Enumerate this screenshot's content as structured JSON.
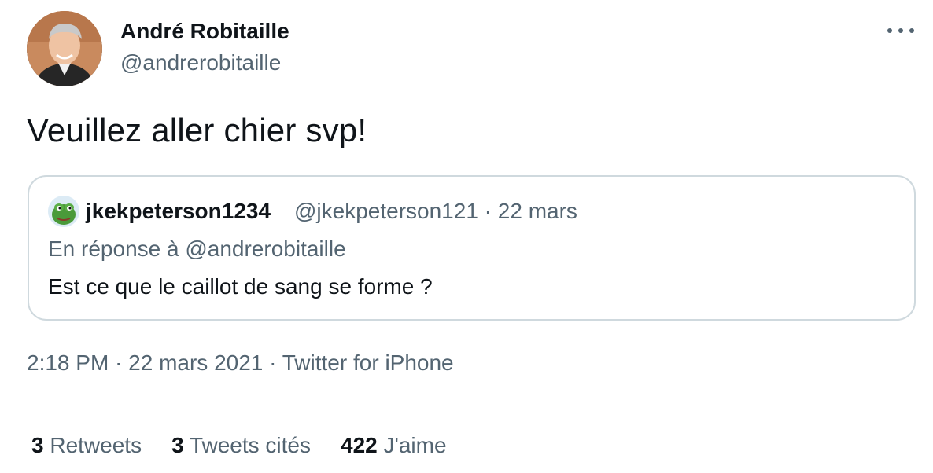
{
  "author": {
    "display_name": "André Robitaille",
    "handle": "@andrerobitaille"
  },
  "tweet": {
    "text": "Veuillez aller chier svp!",
    "timestamp": "2:18 PM · 22 mars 2021 · Twitter for iPhone"
  },
  "quote": {
    "display_name": "jkekpeterson1234",
    "meta": "@jkekpeterson121 · 22 mars",
    "reply_to": "En réponse à @andrerobitaille",
    "text": "Est ce que le caillot de sang se forme ?"
  },
  "stats": {
    "retweets": {
      "count": "3",
      "label": "Retweets"
    },
    "quotes": {
      "count": "3",
      "label": "Tweets cités"
    },
    "likes": {
      "count": "422",
      "label": "J'aime"
    }
  },
  "icons": {
    "more": "more-dots-icon"
  },
  "colors": {
    "text_primary": "#0f1419",
    "text_secondary": "#536471",
    "border": "#cfd9de"
  }
}
